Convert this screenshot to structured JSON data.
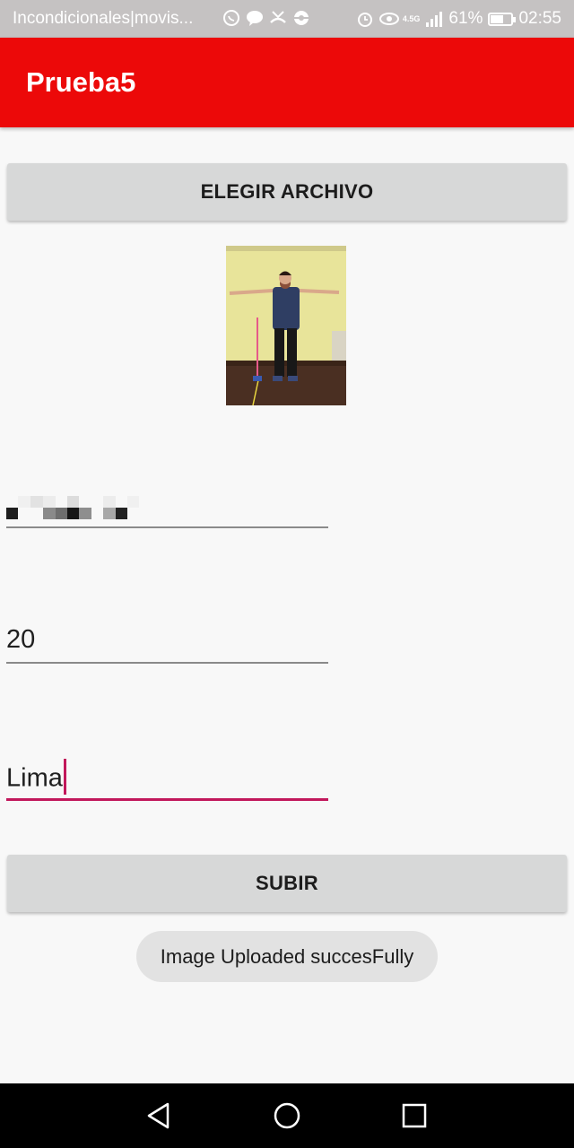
{
  "status_bar": {
    "carrier": "Incondicionales|movis...",
    "notification_icons": [
      "whatsapp-icon",
      "chat-bubble-icon",
      "missed-call-icon",
      "sync-icon"
    ],
    "network": "4.5G",
    "battery_percent": "61%",
    "battery_level": 0.61,
    "time": "02:55"
  },
  "app_bar": {
    "title": "Prueba5",
    "color": "#ec0909"
  },
  "choose_file_button": {
    "label": "ELEGIR ARCHIVO"
  },
  "form": {
    "age_value": "20",
    "city_value": "Lima",
    "accent_color": "#c2185b"
  },
  "upload_button": {
    "label": "SUBIR"
  },
  "toast": {
    "message": "Image Uploaded succesFully"
  },
  "nav_bar": {
    "buttons": [
      "back-icon",
      "home-icon",
      "recents-icon"
    ]
  }
}
